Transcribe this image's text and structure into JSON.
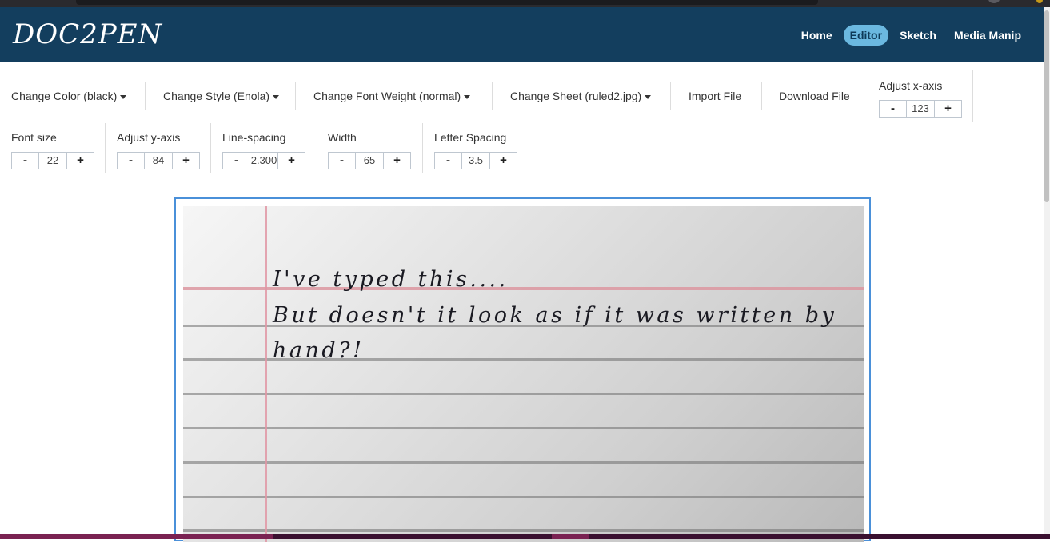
{
  "app": {
    "logo": "DOC2PEN"
  },
  "nav": [
    {
      "label": "Home",
      "active": false
    },
    {
      "label": "Editor",
      "active": true
    },
    {
      "label": "Sketch",
      "active": false
    },
    {
      "label": "Media Manip",
      "active": false
    }
  ],
  "toolbar": {
    "change_color": "Change Color (black)",
    "change_style": "Change Style (Enola)",
    "change_weight": "Change Font Weight (normal)",
    "change_sheet": "Change Sheet (ruled2.jpg)",
    "import_file": "Import File",
    "download_file": "Download File",
    "x_axis": {
      "label": "Adjust x-axis",
      "value": "123",
      "minus": "-",
      "plus": "+"
    },
    "font_size": {
      "label": "Font size",
      "value": "22",
      "minus": "-",
      "plus": "+"
    },
    "y_axis": {
      "label": "Adjust y-axis",
      "value": "84",
      "minus": "-",
      "plus": "+"
    },
    "line_spacing": {
      "label": "Line-spacing",
      "value": "2.300",
      "minus": "-",
      "plus": "+"
    },
    "width": {
      "label": "Width",
      "value": "65",
      "minus": "-",
      "plus": "+"
    },
    "letter_spacing": {
      "label": "Letter Spacing",
      "value": "3.5",
      "minus": "-",
      "plus": "+"
    }
  },
  "preview": {
    "lines": [
      "I've typed this....",
      "But doesn't it look as if it was written by",
      "hand?!"
    ]
  },
  "colors": {
    "navbar": "#133e5e",
    "active_nav": "#6bb8e0",
    "frame": "#4a90d9"
  }
}
